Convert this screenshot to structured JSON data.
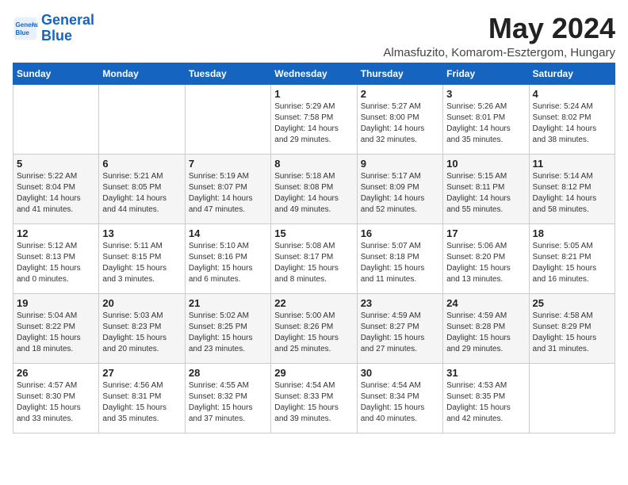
{
  "header": {
    "logo_line1": "General",
    "logo_line2": "Blue",
    "month_year": "May 2024",
    "location": "Almasfuzito, Komarom-Esztergom, Hungary"
  },
  "days_of_week": [
    "Sunday",
    "Monday",
    "Tuesday",
    "Wednesday",
    "Thursday",
    "Friday",
    "Saturday"
  ],
  "weeks": [
    [
      {
        "day": "",
        "info": ""
      },
      {
        "day": "",
        "info": ""
      },
      {
        "day": "",
        "info": ""
      },
      {
        "day": "1",
        "info": "Sunrise: 5:29 AM\nSunset: 7:58 PM\nDaylight: 14 hours\nand 29 minutes."
      },
      {
        "day": "2",
        "info": "Sunrise: 5:27 AM\nSunset: 8:00 PM\nDaylight: 14 hours\nand 32 minutes."
      },
      {
        "day": "3",
        "info": "Sunrise: 5:26 AM\nSunset: 8:01 PM\nDaylight: 14 hours\nand 35 minutes."
      },
      {
        "day": "4",
        "info": "Sunrise: 5:24 AM\nSunset: 8:02 PM\nDaylight: 14 hours\nand 38 minutes."
      }
    ],
    [
      {
        "day": "5",
        "info": "Sunrise: 5:22 AM\nSunset: 8:04 PM\nDaylight: 14 hours\nand 41 minutes."
      },
      {
        "day": "6",
        "info": "Sunrise: 5:21 AM\nSunset: 8:05 PM\nDaylight: 14 hours\nand 44 minutes."
      },
      {
        "day": "7",
        "info": "Sunrise: 5:19 AM\nSunset: 8:07 PM\nDaylight: 14 hours\nand 47 minutes."
      },
      {
        "day": "8",
        "info": "Sunrise: 5:18 AM\nSunset: 8:08 PM\nDaylight: 14 hours\nand 49 minutes."
      },
      {
        "day": "9",
        "info": "Sunrise: 5:17 AM\nSunset: 8:09 PM\nDaylight: 14 hours\nand 52 minutes."
      },
      {
        "day": "10",
        "info": "Sunrise: 5:15 AM\nSunset: 8:11 PM\nDaylight: 14 hours\nand 55 minutes."
      },
      {
        "day": "11",
        "info": "Sunrise: 5:14 AM\nSunset: 8:12 PM\nDaylight: 14 hours\nand 58 minutes."
      }
    ],
    [
      {
        "day": "12",
        "info": "Sunrise: 5:12 AM\nSunset: 8:13 PM\nDaylight: 15 hours\nand 0 minutes."
      },
      {
        "day": "13",
        "info": "Sunrise: 5:11 AM\nSunset: 8:15 PM\nDaylight: 15 hours\nand 3 minutes."
      },
      {
        "day": "14",
        "info": "Sunrise: 5:10 AM\nSunset: 8:16 PM\nDaylight: 15 hours\nand 6 minutes."
      },
      {
        "day": "15",
        "info": "Sunrise: 5:08 AM\nSunset: 8:17 PM\nDaylight: 15 hours\nand 8 minutes."
      },
      {
        "day": "16",
        "info": "Sunrise: 5:07 AM\nSunset: 8:18 PM\nDaylight: 15 hours\nand 11 minutes."
      },
      {
        "day": "17",
        "info": "Sunrise: 5:06 AM\nSunset: 8:20 PM\nDaylight: 15 hours\nand 13 minutes."
      },
      {
        "day": "18",
        "info": "Sunrise: 5:05 AM\nSunset: 8:21 PM\nDaylight: 15 hours\nand 16 minutes."
      }
    ],
    [
      {
        "day": "19",
        "info": "Sunrise: 5:04 AM\nSunset: 8:22 PM\nDaylight: 15 hours\nand 18 minutes."
      },
      {
        "day": "20",
        "info": "Sunrise: 5:03 AM\nSunset: 8:23 PM\nDaylight: 15 hours\nand 20 minutes."
      },
      {
        "day": "21",
        "info": "Sunrise: 5:02 AM\nSunset: 8:25 PM\nDaylight: 15 hours\nand 23 minutes."
      },
      {
        "day": "22",
        "info": "Sunrise: 5:00 AM\nSunset: 8:26 PM\nDaylight: 15 hours\nand 25 minutes."
      },
      {
        "day": "23",
        "info": "Sunrise: 4:59 AM\nSunset: 8:27 PM\nDaylight: 15 hours\nand 27 minutes."
      },
      {
        "day": "24",
        "info": "Sunrise: 4:59 AM\nSunset: 8:28 PM\nDaylight: 15 hours\nand 29 minutes."
      },
      {
        "day": "25",
        "info": "Sunrise: 4:58 AM\nSunset: 8:29 PM\nDaylight: 15 hours\nand 31 minutes."
      }
    ],
    [
      {
        "day": "26",
        "info": "Sunrise: 4:57 AM\nSunset: 8:30 PM\nDaylight: 15 hours\nand 33 minutes."
      },
      {
        "day": "27",
        "info": "Sunrise: 4:56 AM\nSunset: 8:31 PM\nDaylight: 15 hours\nand 35 minutes."
      },
      {
        "day": "28",
        "info": "Sunrise: 4:55 AM\nSunset: 8:32 PM\nDaylight: 15 hours\nand 37 minutes."
      },
      {
        "day": "29",
        "info": "Sunrise: 4:54 AM\nSunset: 8:33 PM\nDaylight: 15 hours\nand 39 minutes."
      },
      {
        "day": "30",
        "info": "Sunrise: 4:54 AM\nSunset: 8:34 PM\nDaylight: 15 hours\nand 40 minutes."
      },
      {
        "day": "31",
        "info": "Sunrise: 4:53 AM\nSunset: 8:35 PM\nDaylight: 15 hours\nand 42 minutes."
      },
      {
        "day": "",
        "info": ""
      }
    ]
  ]
}
